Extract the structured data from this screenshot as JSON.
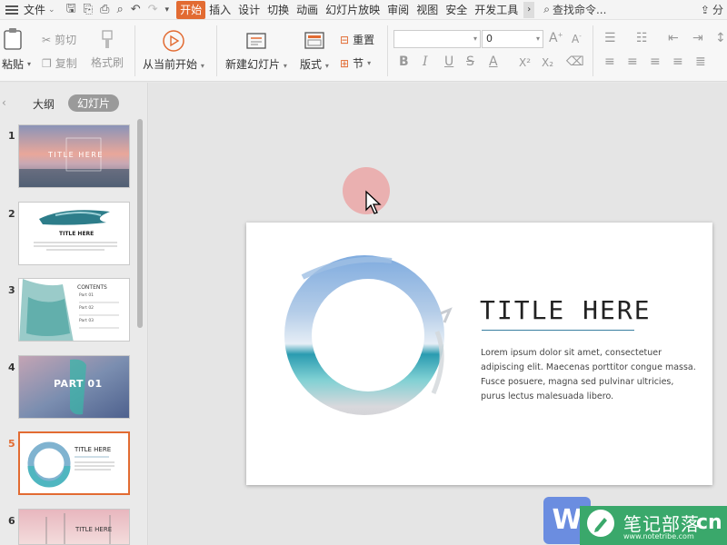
{
  "menubar": {
    "file_label": "文件",
    "tabs": [
      "开始",
      "插入",
      "设计",
      "切换",
      "动画",
      "幻灯片放映",
      "审阅",
      "视图",
      "安全",
      "开发工具"
    ],
    "active_tab": "开始",
    "search_placeholder": "查找命令...",
    "share_label": "分"
  },
  "ribbon": {
    "paste": "粘贴",
    "cut": "剪切",
    "copy": "复制",
    "format_painter": "格式刷",
    "play_from_current": "从当前开始",
    "new_slide": "新建幻灯片",
    "layout": "版式",
    "reset": "重置",
    "section": "节",
    "font_name_value": "",
    "font_size_value": "0",
    "font_buttons": [
      "B",
      "I",
      "U",
      "S",
      "A",
      "X²",
      "X₂"
    ]
  },
  "left_panel": {
    "tab_outline": "大纲",
    "tab_slides": "幻灯片",
    "thumbnails": [
      {
        "num": "1",
        "title": "TITLE HERE"
      },
      {
        "num": "2",
        "title": "TITLE HERE"
      },
      {
        "num": "3",
        "title": "CONTENTS",
        "items": [
          "Part 01",
          "Part 02",
          "Part 03"
        ]
      },
      {
        "num": "4",
        "title": "PART 01"
      },
      {
        "num": "5",
        "title": "TITLE HERE"
      },
      {
        "num": "6",
        "title": "TITLE HERE"
      }
    ],
    "selected_index": 5
  },
  "slide": {
    "title": "TITLE HERE",
    "body": "Lorem ipsum dolor sit amet, consectetuer adipiscing elit. Maecenas porttitor congue massa. Fusce posuere, magna sed pulvinar ultricies, purus lectus malesuada libero."
  },
  "watermark": {
    "logo_letter": "W",
    "title": "笔记部落",
    "url": "www.notetribe.com",
    "suffix": "cn"
  },
  "colors": {
    "accent": "#e26b32",
    "slide_rule": "#3a7fa0",
    "watermark_green": "#3aa86b",
    "watermark_blue": "#6b8de0"
  }
}
